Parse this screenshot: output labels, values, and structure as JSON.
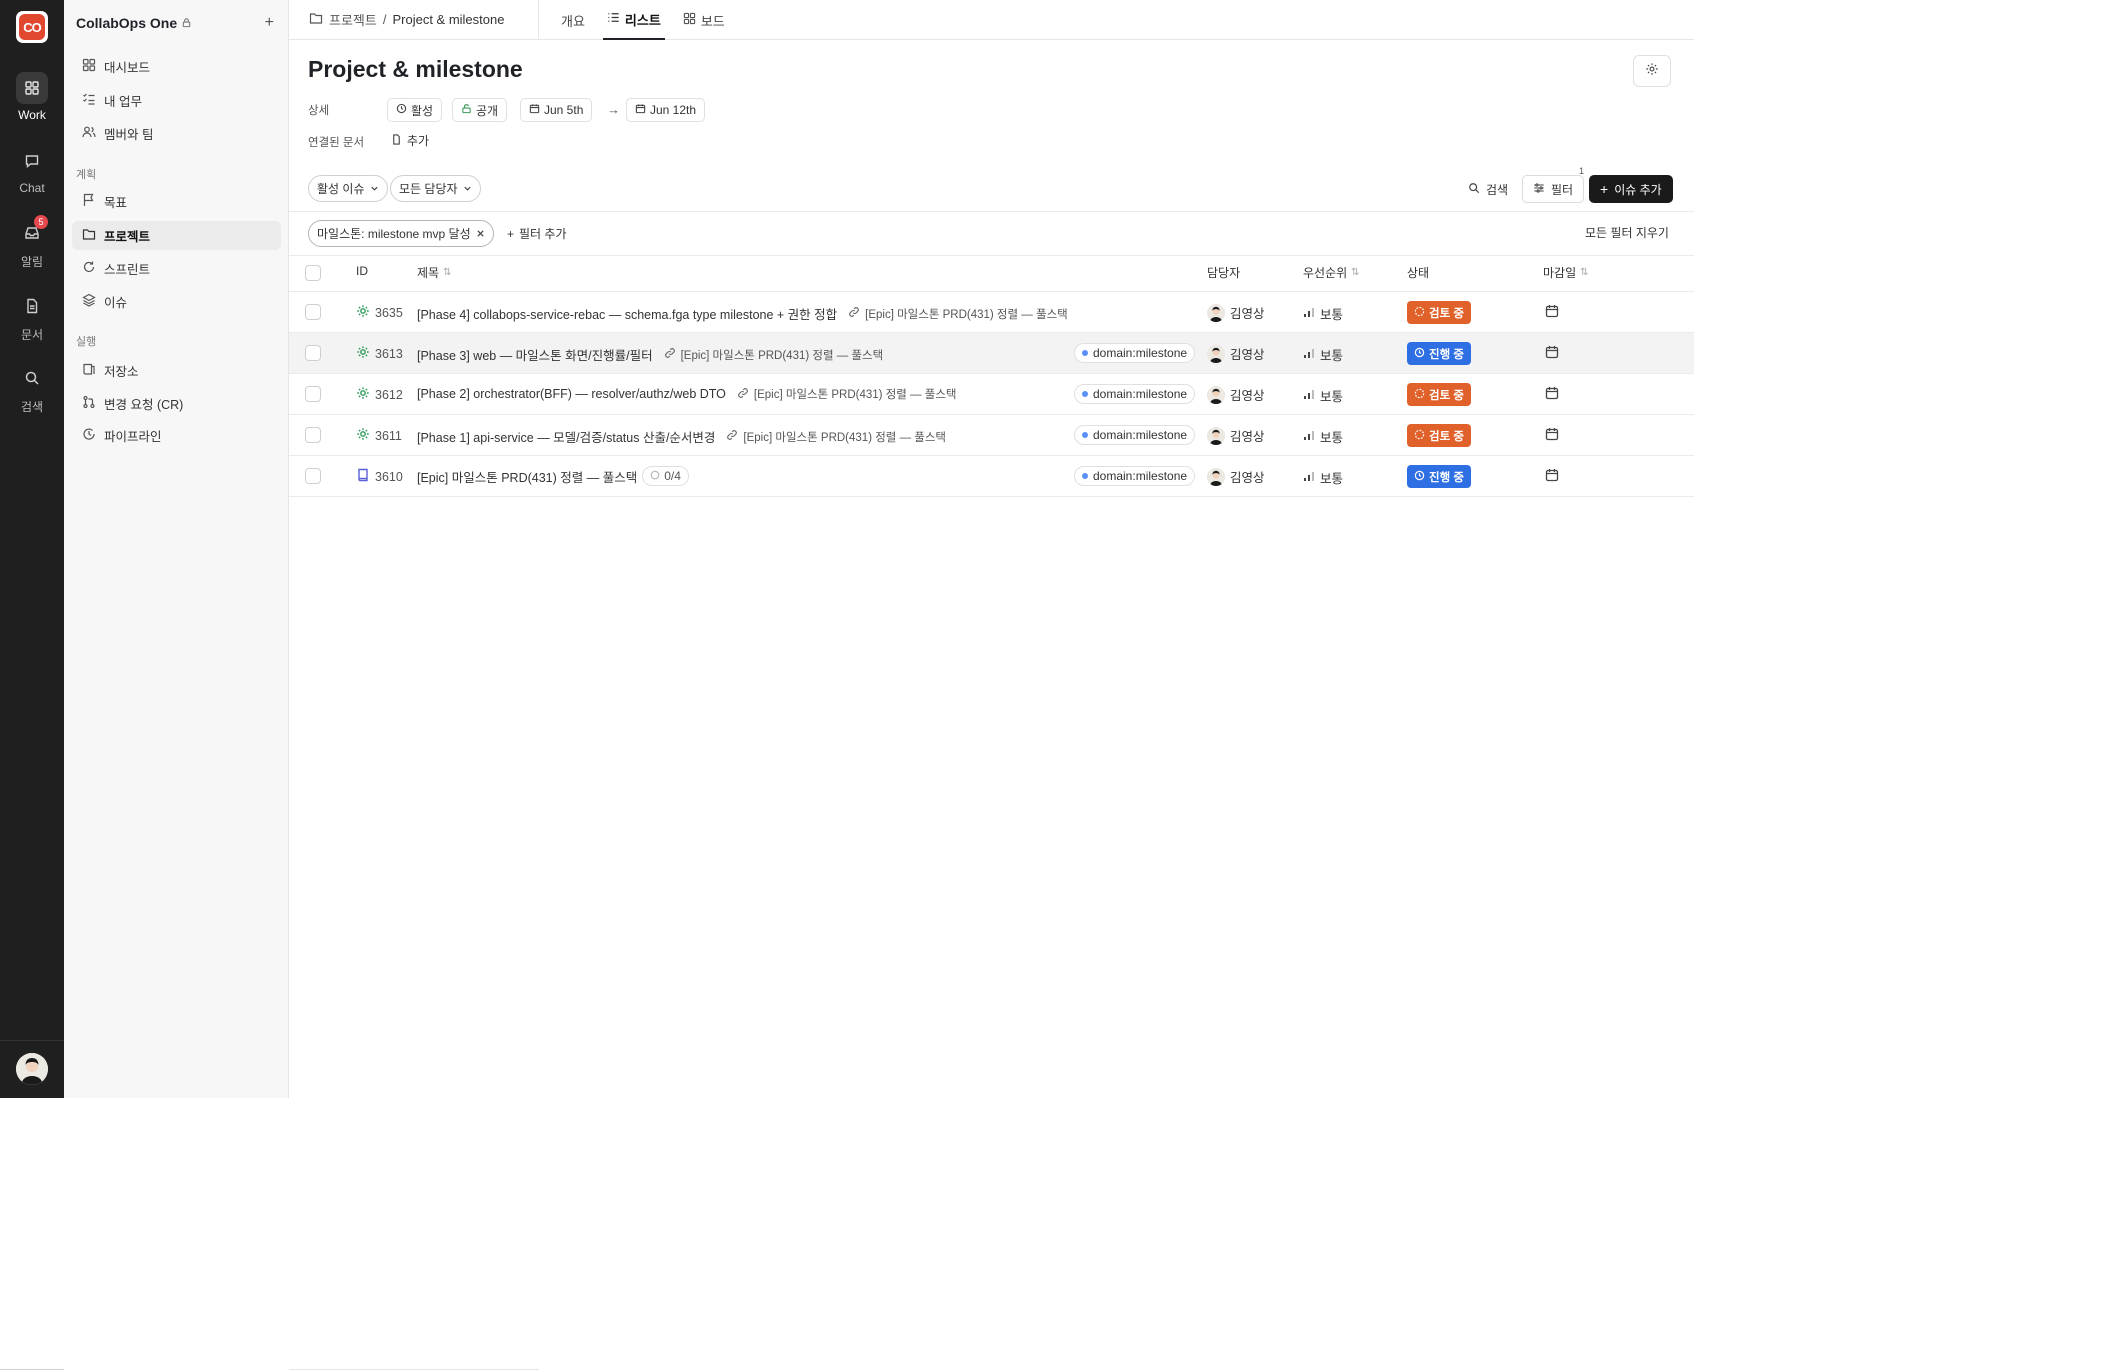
{
  "rail": {
    "logo_text": "CO",
    "items": [
      {
        "label": "Work",
        "icon": "grid-icon"
      },
      {
        "label": "Chat",
        "icon": "chat-icon"
      },
      {
        "label": "알림",
        "icon": "inbox-icon",
        "badge": "5"
      },
      {
        "label": "문서",
        "icon": "document-icon"
      },
      {
        "label": "검색",
        "icon": "search-icon"
      }
    ]
  },
  "sidebar": {
    "workspace": "CollabOps One",
    "top_items": [
      {
        "label": "대시보드",
        "icon": "dashboard-icon"
      },
      {
        "label": "내 업무",
        "icon": "task-list-icon"
      },
      {
        "label": "멤버와 팀",
        "icon": "members-icon"
      }
    ],
    "section_plan": "계획",
    "plan_items": [
      {
        "label": "목표",
        "icon": "flag-icon"
      },
      {
        "label": "프로젝트",
        "icon": "folder-icon"
      },
      {
        "label": "스프린트",
        "icon": "sprint-icon"
      },
      {
        "label": "이슈",
        "icon": "layers-icon"
      }
    ],
    "section_exec": "실행",
    "exec_items": [
      {
        "label": "저장소",
        "icon": "repo-icon"
      },
      {
        "label": "변경 요청 (CR)",
        "icon": "pull-request-icon"
      },
      {
        "label": "파이프라인",
        "icon": "pipeline-icon"
      }
    ]
  },
  "topbar": {
    "breadcrumb_root": "프로젝트",
    "breadcrumb_sep": "/",
    "breadcrumb_current": "Project & milestone",
    "tabs": [
      {
        "label": "개요"
      },
      {
        "label": "리스트"
      },
      {
        "label": "보드"
      }
    ]
  },
  "main": {
    "title": "Project & milestone",
    "detail_label": "상세",
    "status_chip": "활성",
    "visibility_chip": "공개",
    "start_date": "Jun 5th",
    "end_date": "Jun 12th",
    "arrow": "→",
    "linked_docs_label": "연결된 문서",
    "add_doc": "추가",
    "filter_active_issues": "활성 이슈",
    "filter_all_assignees": "모든 담당자",
    "search_label": "검색",
    "filter_label": "필터",
    "filter_count": "1",
    "add_issue_label": "이슈 추가",
    "active_filter": "마일스톤: milestone mvp 달성",
    "add_filter": "필터 추가",
    "clear_filters": "모든 필터 지우기"
  },
  "table": {
    "headers": {
      "id": "ID",
      "title": "제목",
      "assignee": "담당자",
      "priority": "우선순위",
      "status": "상태",
      "due": "마감일"
    },
    "rows": [
      {
        "id": "3635",
        "title": "[Phase 4] collabops-service-rebac — schema.fga type milestone + 권한 정합",
        "epic": "[Epic] 마일스톤 PRD(431) 정렬 — 풀스택",
        "label": "",
        "assignee": "김영상",
        "priority": "보통",
        "status": "검토 중",
        "status_kind": "review"
      },
      {
        "id": "3613",
        "title": "[Phase 3] web — 마일스톤 화면/진행률/필터",
        "epic": "[Epic] 마일스톤 PRD(431) 정렬 — 풀스택",
        "label": "domain:milestone",
        "assignee": "김영상",
        "priority": "보통",
        "status": "진행 중",
        "status_kind": "progress"
      },
      {
        "id": "3612",
        "title": "[Phase 2] orchestrator(BFF) — resolver/authz/web DTO",
        "epic": "[Epic] 마일스톤 PRD(431) 정렬 — 풀스택",
        "label": "domain:milestone",
        "assignee": "김영상",
        "priority": "보통",
        "status": "검토 중",
        "status_kind": "review"
      },
      {
        "id": "3611",
        "title": "[Phase 1] api-service — 모델/검증/status 산출/순서변경",
        "epic": "[Epic] 마일스톤 PRD(431) 정렬 — 풀스택",
        "label": "domain:milestone",
        "assignee": "김영상",
        "priority": "보통",
        "status": "검토 중",
        "status_kind": "review"
      },
      {
        "id": "3610",
        "title": "[Epic] 마일스톤 PRD(431) 정렬 — 풀스택",
        "epic": "",
        "progress": "0/4",
        "label": "domain:milestone",
        "assignee": "김영상",
        "priority": "보통",
        "status": "진행 중",
        "status_kind": "progress"
      }
    ]
  },
  "colors": {
    "review": "#e0612a",
    "progress": "#2f6fe4",
    "rail_bg": "#1f1f1f",
    "accent_logo": "#e0492f"
  }
}
